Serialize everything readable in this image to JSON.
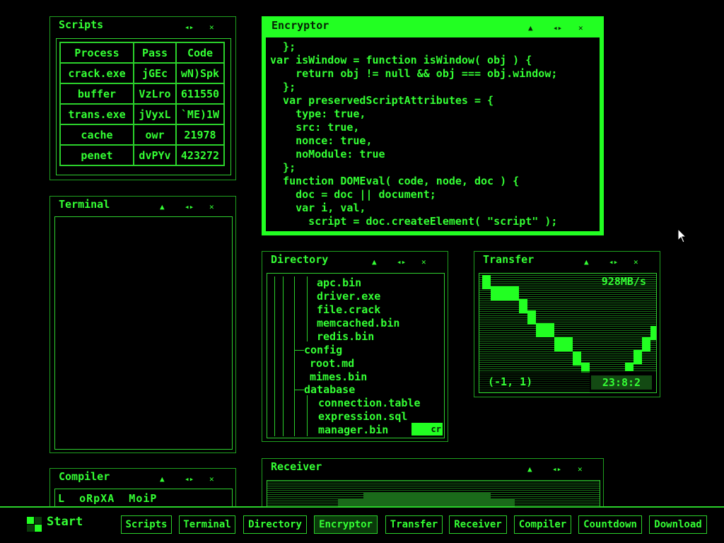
{
  "windows": {
    "scripts": {
      "title": "Scripts",
      "headers": [
        "Process",
        "Pass",
        "Code"
      ],
      "rows": [
        [
          "crack.exe",
          "jGEc",
          "wN)Spk"
        ],
        [
          "buffer",
          "VzLro",
          "611550"
        ],
        [
          "trans.exe",
          "jVyxL",
          "`ME)1W"
        ],
        [
          "cache",
          "owr",
          "21978"
        ],
        [
          "penet",
          "dvPYv",
          "423272"
        ]
      ]
    },
    "encryptor": {
      "title": "Encryptor",
      "code": "  };\nvar isWindow = function isWindow( obj ) {\n    return obj != null && obj === obj.window;\n  };\n  var preservedScriptAttributes = {\n    type: true,\n    src: true,\n    nonce: true,\n    noModule: true\n  };\n  function DOMEval( code, node, doc ) {\n    doc = doc || document;\n    var i, val,\n      script = doc.createElement( \"script\" );"
    },
    "terminal": {
      "title": "Terminal"
    },
    "directory": {
      "title": "Directory",
      "items": [
        "apc.bin",
        "driver.exe",
        "file.crack",
        "memcached.bin",
        "redis.bin",
        "config",
        "root.md",
        "mimes.bin",
        "database",
        "connection.table",
        "expression.sql",
        "manager.bin"
      ],
      "highlight": "cr"
    },
    "transfer": {
      "title": "Transfer",
      "speed": "928MB/s",
      "coords": "(-1, 1)",
      "time": "23:8:2"
    },
    "compiler": {
      "title": "Compiler",
      "text": "L  oRpXA  MoiP"
    },
    "receiver": {
      "title": "Receiver"
    }
  },
  "controls": {
    "minimize_glyph": "▲",
    "resize_glyph": "◂▸",
    "close_glyph": "✕"
  },
  "taskbar": {
    "start_label": "Start",
    "buttons": [
      "Scripts",
      "Terminal",
      "Directory",
      "Encryptor",
      "Transfer",
      "Receiver",
      "Compiler",
      "Countdown",
      "Download"
    ]
  }
}
